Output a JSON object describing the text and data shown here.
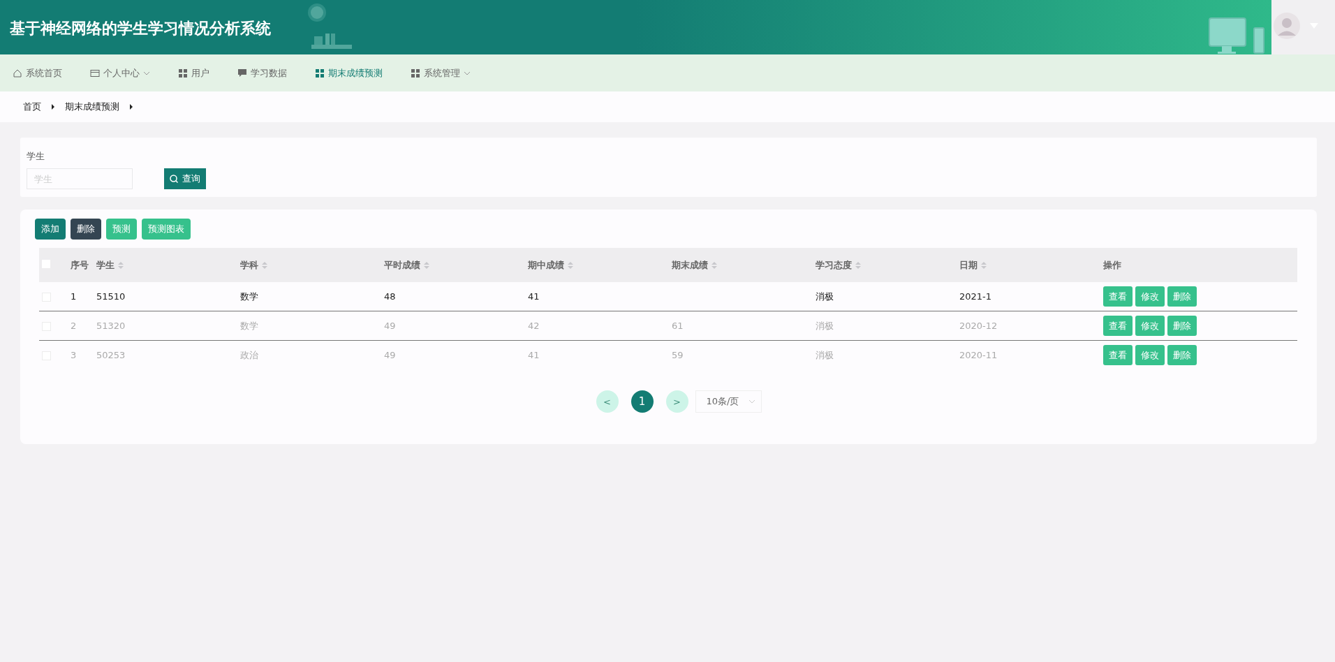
{
  "header": {
    "title": "基于神经网络的学生学习情况分析系统"
  },
  "nav": [
    {
      "label": "系统首页",
      "kind": "home",
      "selected": false,
      "dropdown": false
    },
    {
      "label": "个人中心",
      "kind": "card",
      "selected": false,
      "dropdown": true
    },
    {
      "label": "用户",
      "kind": "grid",
      "selected": false,
      "dropdown": false
    },
    {
      "label": "学习数据",
      "kind": "chat",
      "selected": false,
      "dropdown": false
    },
    {
      "label": "期末成绩预测",
      "kind": "grid",
      "selected": true,
      "dropdown": false
    },
    {
      "label": "系统管理",
      "kind": "grid",
      "selected": false,
      "dropdown": true
    }
  ],
  "breadcrumb": [
    "首页",
    "期末成绩预测"
  ],
  "search": {
    "label": "学生",
    "placeholder": "学生",
    "button": "查询"
  },
  "toolbar": [
    {
      "label": "添加",
      "kind": "primary"
    },
    {
      "label": "删除",
      "kind": "dark"
    },
    {
      "label": "预测",
      "kind": "light"
    },
    {
      "label": "预测图表",
      "kind": "light"
    }
  ],
  "table": {
    "select_all_checked": false,
    "columns": [
      {
        "label": "序号",
        "sortable": false
      },
      {
        "label": "学生",
        "sortable": true
      },
      {
        "label": "学科",
        "sortable": true
      },
      {
        "label": "平时成绩",
        "sortable": true
      },
      {
        "label": "期中成绩",
        "sortable": true
      },
      {
        "label": "期末成绩",
        "sortable": true
      },
      {
        "label": "学习态度",
        "sortable": true
      },
      {
        "label": "日期",
        "sortable": true
      },
      {
        "label": "操作",
        "sortable": false
      }
    ],
    "rows": [
      {
        "checked": false,
        "faded": false,
        "cells": [
          "1",
          "51510",
          "数学",
          "48",
          "41",
          null,
          "消极",
          "2021-1"
        ],
        "actions": [
          "查看",
          "修改",
          "删除"
        ]
      },
      {
        "checked": false,
        "faded": true,
        "cells": [
          "2",
          "51320",
          "数学",
          "49",
          "42",
          "61",
          "消极",
          "2020-12"
        ],
        "actions": [
          "查看",
          "修改",
          "删除"
        ]
      },
      {
        "checked": false,
        "faded": true,
        "cells": [
          "3",
          "50253",
          "政治",
          "49",
          "41",
          "59",
          "消极",
          "2020-11"
        ],
        "actions": [
          "查看",
          "修改",
          "删除"
        ]
      }
    ]
  },
  "pagination": {
    "prev": "<",
    "pages": [
      {
        "label": "1",
        "selected": true
      }
    ],
    "next": ">",
    "page_size": "10条/页"
  }
}
